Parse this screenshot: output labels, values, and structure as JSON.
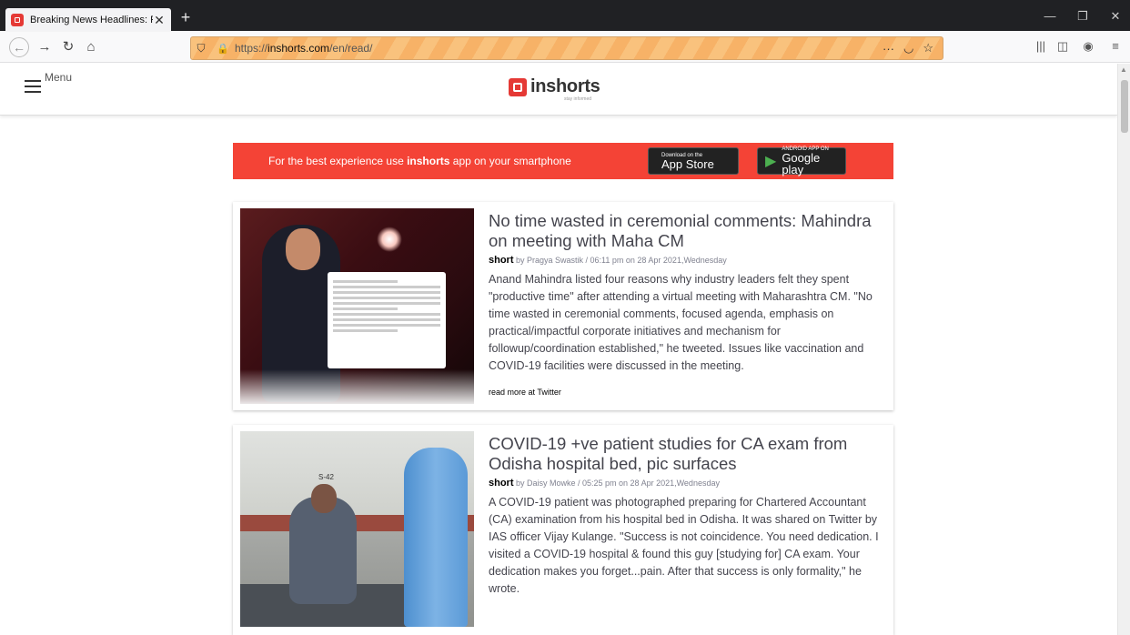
{
  "browser": {
    "tab_title": "Breaking News Headlines: Read",
    "new_tab_symbol": "+",
    "url_host": "https://",
    "url_domain": "inshorts.com",
    "url_path": "/en/read/",
    "more_label": "···"
  },
  "site": {
    "menu_label": "Menu",
    "logo_text": "inshorts",
    "logo_tagline": "stay informed",
    "banner": {
      "prefix": "For the best experience use ",
      "brand": "inshorts",
      "suffix": " app on your smartphone",
      "appstore_small": "Download on the",
      "appstore_big": "App Store",
      "google_small": "ANDROID APP ON",
      "google_big": "Google play"
    }
  },
  "articles": [
    {
      "headline": "No time wasted in ceremonial comments: Mahindra on meeting with Maha CM",
      "label": "short",
      "byline": " by Pragya Swastik / 06:11 pm on 28 Apr 2021,Wednesday",
      "body": "Anand Mahindra listed four reasons why industry leaders felt they spent \"productive time\" after attending a virtual meeting with Maharashtra CM. \"No time wasted in ceremonial comments, focused agenda, emphasis on practical/impactful corporate initiatives and mechanism for followup/coordination established,\" he tweeted. Issues like vaccination and COVID-19 facilities were discussed in the meeting.",
      "read_more": "read more at Twitter"
    },
    {
      "headline": "COVID-19 +ve patient studies for CA exam from Odisha hospital bed, pic surfaces",
      "label": "short",
      "byline": " by Daisy Mowke / 05:25 pm on 28 Apr 2021,Wednesday",
      "body": "A COVID-19 patient was photographed preparing for Chartered Accountant (CA) examination from his hospital bed in Odisha. It was shared on Twitter by IAS officer Vijay Kulange. \"Success is not coincidence. You need dedication. I visited a COVID-19 hospital & found this guy [studying for] CA exam. Your dedication makes you forget...pain. After that success is only formality,\" he wrote.",
      "image_label": "S-42"
    }
  ]
}
